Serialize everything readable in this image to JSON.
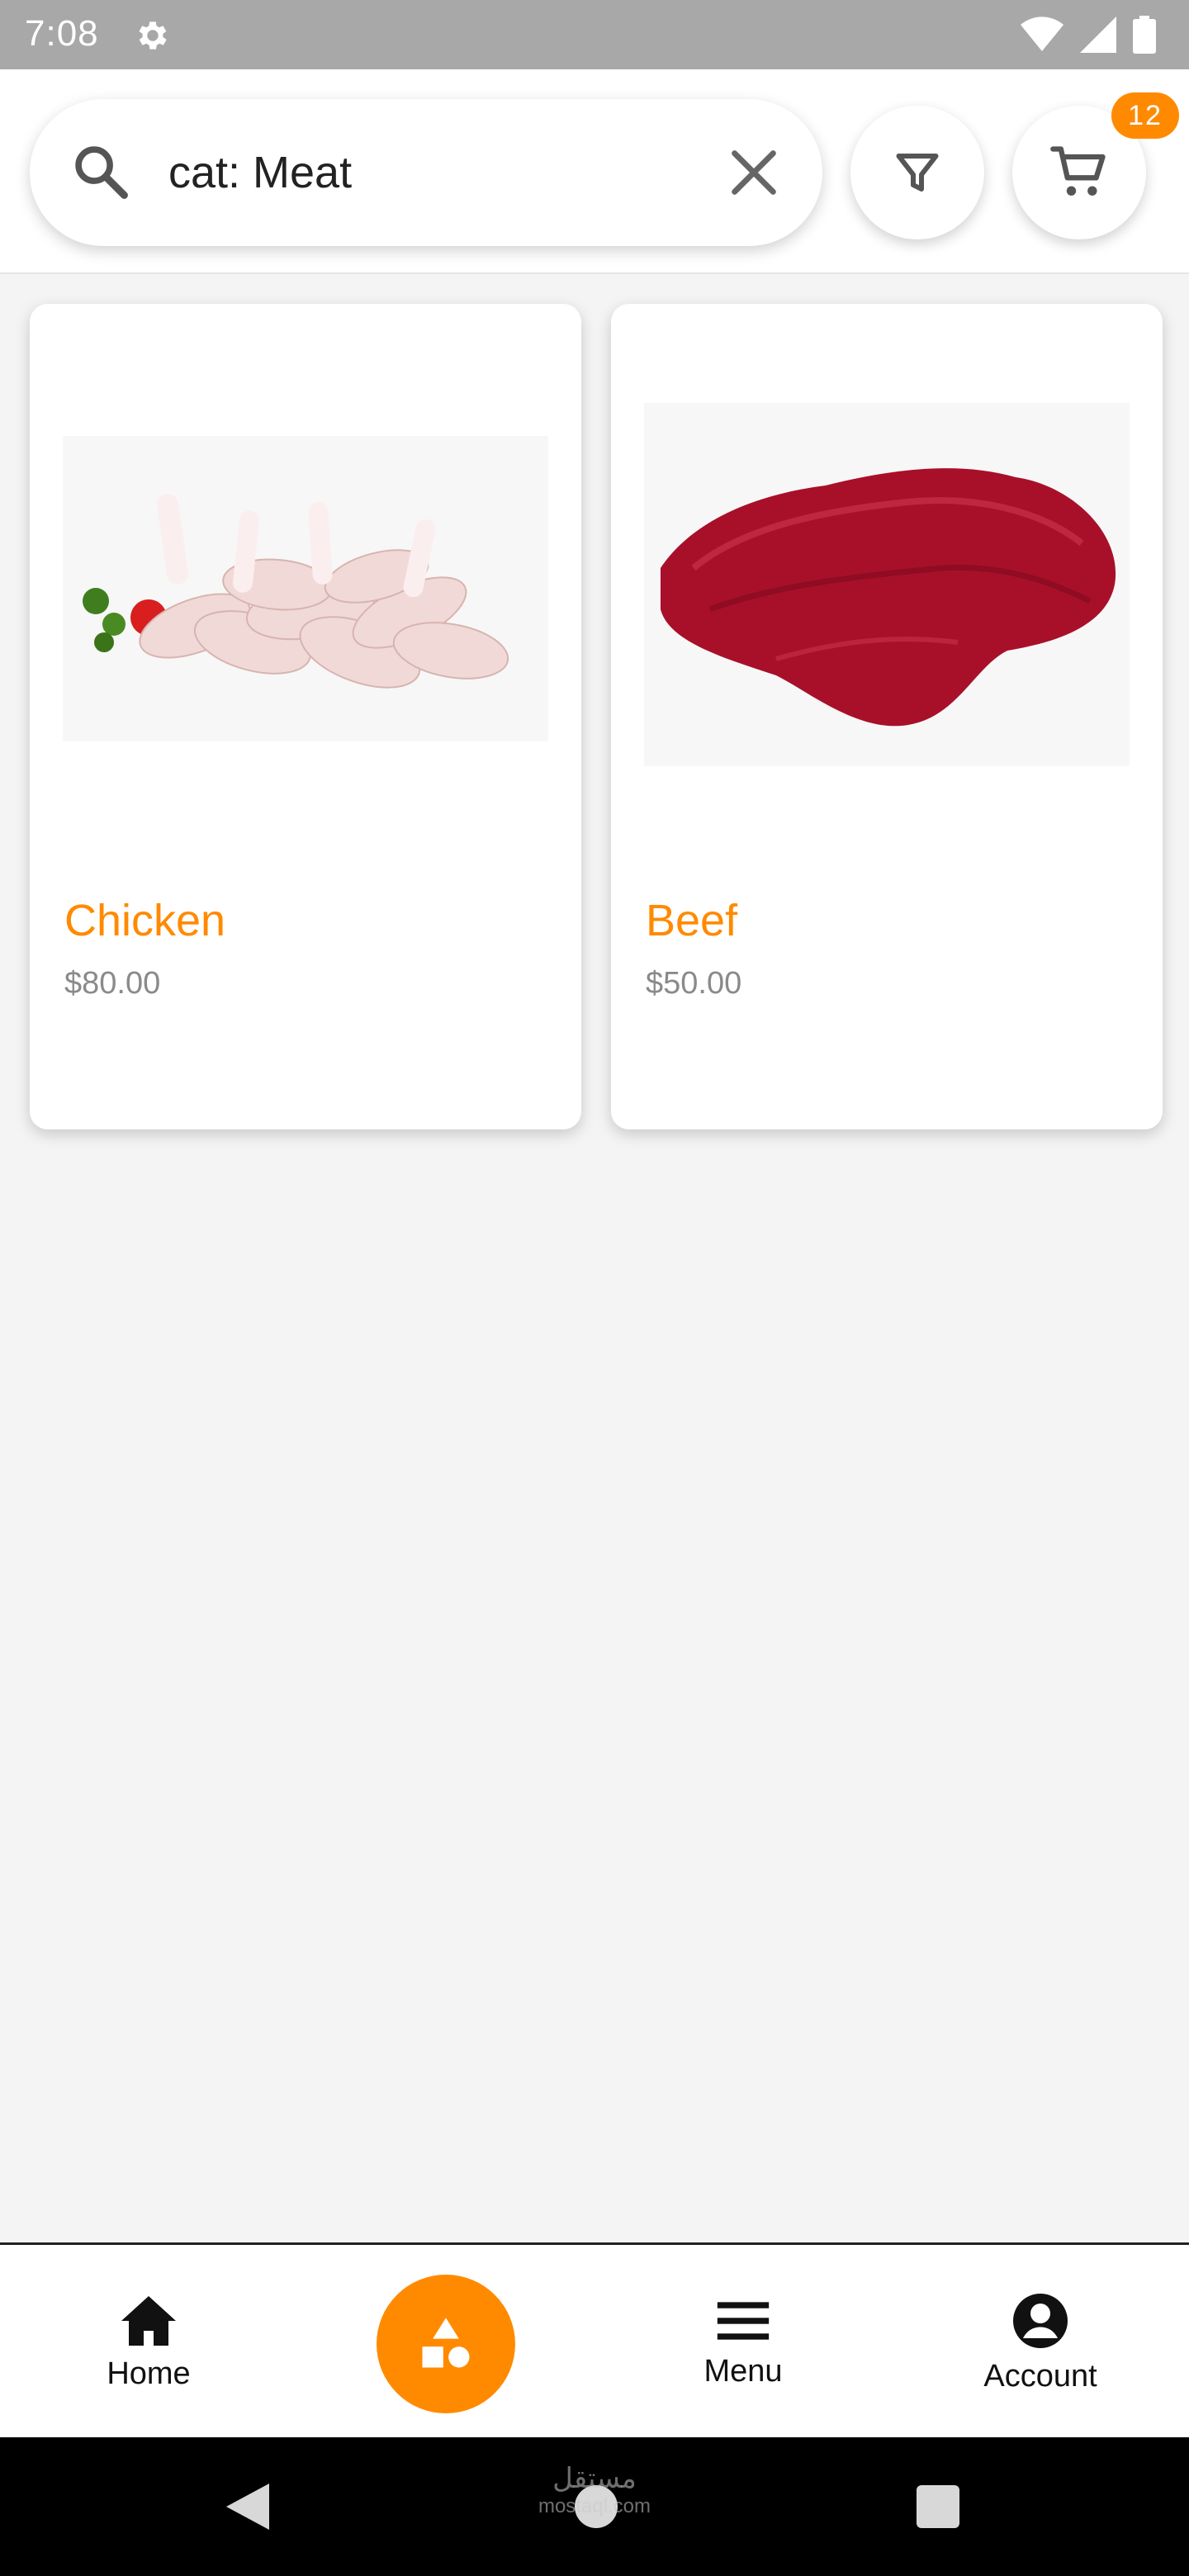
{
  "status_bar": {
    "time": "7:08",
    "icons": [
      "settings-icon",
      "wifi-icon",
      "signal-icon",
      "battery-icon"
    ]
  },
  "search": {
    "value": "cat: Meat",
    "icon": "search-icon",
    "clear_icon": "close-icon"
  },
  "header": {
    "filter_icon": "filter-icon",
    "cart_icon": "cart-icon",
    "cart_count": "12"
  },
  "products": [
    {
      "name": "Chicken",
      "price": "$80.00",
      "image": "chicken-drumsticks"
    },
    {
      "name": "Beef",
      "price": "$50.00",
      "image": "raw-beef"
    }
  ],
  "bottom_nav": {
    "home_label": "Home",
    "menu_label": "Menu",
    "account_label": "Account",
    "fab_icon": "categories-icon"
  },
  "system_nav": {
    "watermark": "مستقل",
    "watermark_sub": "mostaql.com"
  },
  "colors": {
    "accent": "#ff8a00",
    "background": "#f4f4f4",
    "status_bar": "#a8a8a8",
    "price_text": "#8a8a8a"
  }
}
